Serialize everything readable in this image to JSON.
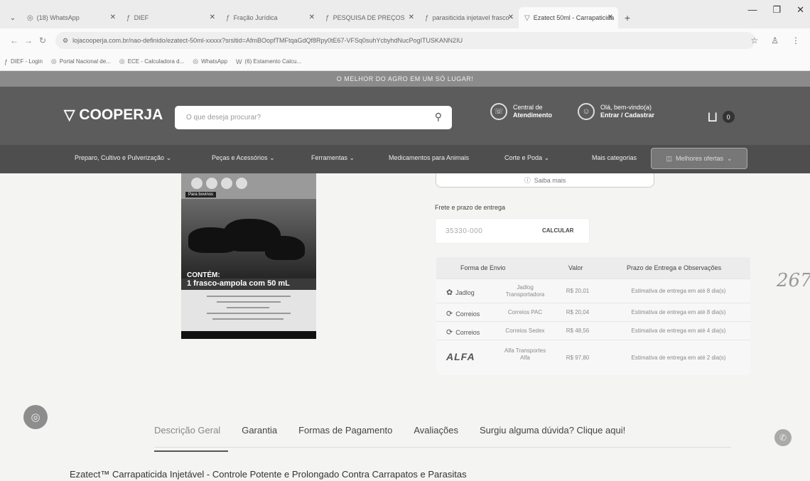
{
  "browser": {
    "tabs": [
      {
        "label": "(18) WhatsApp",
        "active": false
      },
      {
        "label": "DIEF",
        "active": false
      },
      {
        "label": "Fração Jurídica",
        "active": false
      },
      {
        "label": "PESQUISA DE PREÇOS",
        "active": false
      },
      {
        "label": "parasiticida injetavel frasco -",
        "active": false
      },
      {
        "label": "Ezatect 50ml - Carrapaticida",
        "active": true
      }
    ],
    "url": "lojacooperja.com.br/nao-definido/ezatect-50ml-xxxxx?srsltid=AfmBOopfTMFtqaGdQf8Rpy0tE67-VFSq0suhYcbyhdNucPogITUSKANN2IU",
    "bookmarks": [
      {
        "label": "DIEF - Login",
        "icon": "document-icon"
      },
      {
        "label": "Portal Nacional de...",
        "icon": "globe-icon"
      },
      {
        "label": "ECE - Calculadora d...",
        "icon": "globe-icon"
      },
      {
        "label": "WhatsApp",
        "icon": "globe-icon"
      },
      {
        "label": "(6) Estamento Calcu...",
        "icon": "word-icon"
      }
    ]
  },
  "site": {
    "promo_text": "O MELHOR DO AGRO EM UM SÓ LUGAR!",
    "logo_text": "COOPERJA",
    "search_placeholder": "O que deseja procurar?",
    "support": {
      "line1": "Central de",
      "line2": "Atendimento"
    },
    "account": {
      "line1": "Olá, bem-vindo(a)",
      "line2": "Entrar / Cadastrar"
    },
    "cart_count": "0",
    "categories": [
      "Preparo, Cultivo e Pulverização",
      "Peças e Acessórios",
      "Ferramentas",
      "Medicamentos para Animais",
      "Corte e Poda",
      "Mais categorias"
    ],
    "offers_label": "Melhores ofertas"
  },
  "product": {
    "image": {
      "tag": "Para bovinos",
      "contem": "CONTÉM:",
      "frasco": "1 frasco-ampola com 50 mL"
    },
    "saiba_mais": "Saiba mais",
    "frete_label": "Frete e prazo de entrega",
    "cep_value": "35330-000",
    "calcular_label": "CALCULAR",
    "shipping": {
      "headers": [
        "Forma de Envio",
        "Valor",
        "Prazo de Entrega e Observações"
      ],
      "rows": [
        {
          "carrier": "Jadlog",
          "method": "Jadlog Transportadora",
          "value": "R$ 20,01",
          "deadline": "Estimativa de entrega em até 8 dia(s)"
        },
        {
          "carrier": "Correios",
          "method": "Correios PAC",
          "value": "R$ 20,04",
          "deadline": "Estimativa de entrega em até 8 dia(s)"
        },
        {
          "carrier": "Correios",
          "method": "Correios Sedex",
          "value": "R$ 48,56",
          "deadline": "Estimativa de entrega em até 4 dia(s)"
        },
        {
          "carrier": "ALFA",
          "method": "Alfa Transportes Alfa",
          "value": "R$ 97,80",
          "deadline": "Estimativa de entrega em até 2 dia(s)"
        }
      ]
    },
    "handwritten_note": "267",
    "tabs": [
      "Descrição Geral",
      "Garantia",
      "Formas de Pagamento",
      "Avaliações",
      "Surgiu alguma dúvida? Clique aqui!"
    ],
    "description_title": "Ezatect™ Carrapaticida Injetável - Controle Potente e Prolongado Contra Carrapatos e Parasitas"
  }
}
